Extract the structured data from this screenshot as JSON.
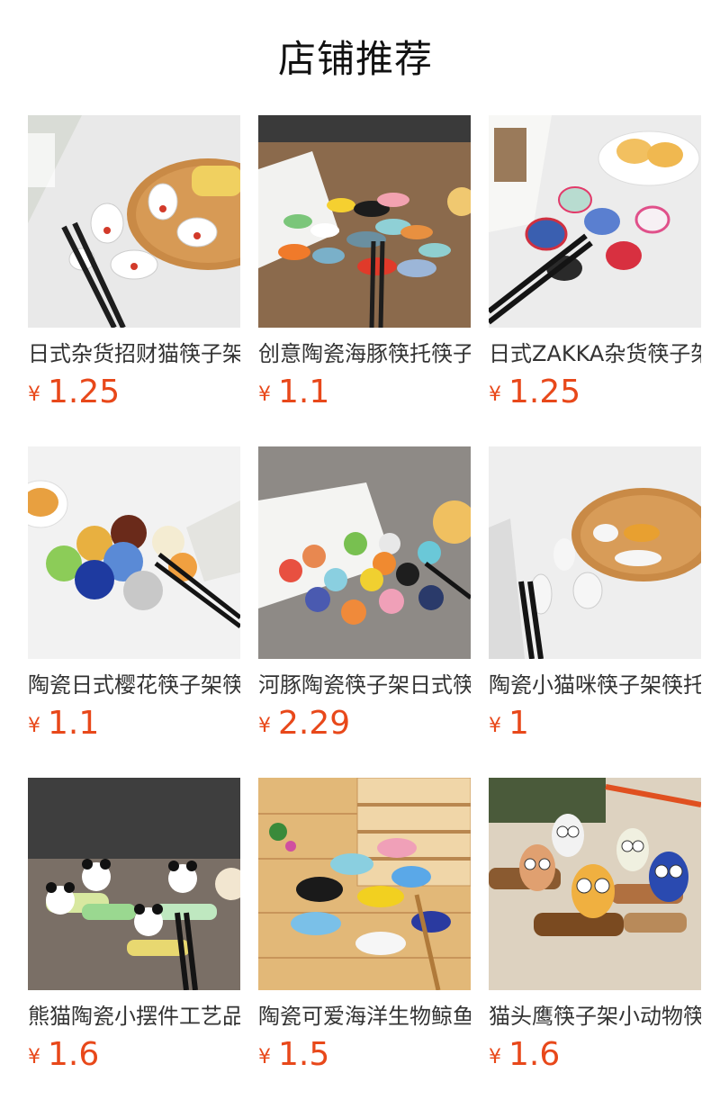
{
  "page": {
    "title": "店铺推荐"
  },
  "currency_symbol": "¥",
  "accent_color": "#e8481a",
  "products": [
    {
      "name": "日式杂货招财猫筷子架筷托",
      "price": "1.25"
    },
    {
      "name": "创意陶瓷海豚筷托筷子架",
      "price": "1.1"
    },
    {
      "name": "日式ZAKKA杂货筷子架",
      "price": "1.25"
    },
    {
      "name": "陶瓷日式樱花筷子架筷托",
      "price": "1.1"
    },
    {
      "name": "河豚陶瓷筷子架日式筷托",
      "price": "2.29"
    },
    {
      "name": "陶瓷小猫咪筷子架筷托",
      "price": "1"
    },
    {
      "name": "熊猫陶瓷小摆件工艺品",
      "price": "1.6"
    },
    {
      "name": "陶瓷可爱海洋生物鲸鱼",
      "price": "1.5"
    },
    {
      "name": "猫头鹰筷子架小动物筷托",
      "price": "1.6"
    }
  ]
}
